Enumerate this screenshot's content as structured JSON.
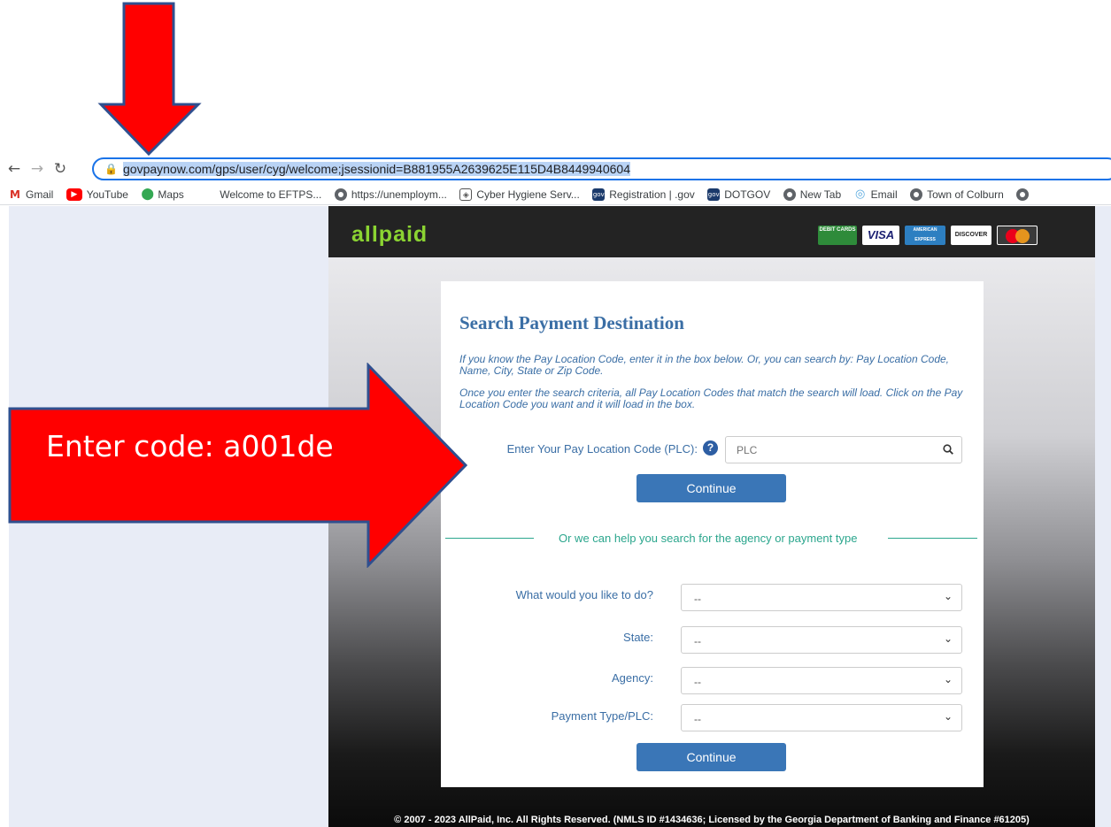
{
  "browser": {
    "url_highlighted": "govpaynow.com/gps/user/cyg/welcome",
    "url_rest": ";jsessionid=B881955A2639625E115D4B8449940604"
  },
  "bookmarks": [
    {
      "label": "Gmail",
      "icon": "gmail-icon"
    },
    {
      "label": "YouTube",
      "icon": "youtube-icon"
    },
    {
      "label": "Maps",
      "icon": "maps-icon"
    },
    {
      "label": "Welcome to EFTPS...",
      "icon": "none"
    },
    {
      "label": "https://unemploym...",
      "icon": "globe-icon"
    },
    {
      "label": "Cyber Hygiene Serv...",
      "icon": "shield-icon"
    },
    {
      "label": "Registration | .gov",
      "icon": "gov-icon"
    },
    {
      "label": "DOTGOV",
      "icon": "gov-icon"
    },
    {
      "label": "New Tab",
      "icon": "globe-icon"
    },
    {
      "label": "Email",
      "icon": "email-icon"
    },
    {
      "label": "Town of Colburn",
      "icon": "globe-icon"
    }
  ],
  "site": {
    "logo": "allpaid",
    "cards": [
      "DEBIT CARDS",
      "VISA",
      "AMERICAN EXPRESS",
      "DISCOVER",
      "mastercard"
    ],
    "title": "Search Payment Destination",
    "intro1": "If you know the Pay Location Code, enter it in the box below. Or, you can search by: Pay Location Code, Name, City, State or Zip Code.",
    "intro2": "Once you enter the search criteria, all Pay Location Codes that match the search will load. Click on the Pay Location Code you want and it will load in the box.",
    "plc_label": "Enter Your Pay Location Code (PLC):",
    "plc_placeholder": "PLC",
    "continue": "Continue",
    "help_text": "Or we can help you search for the agency or payment type",
    "selects": [
      {
        "label": "What would you like to do?",
        "value": "--"
      },
      {
        "label": "State:",
        "value": "--"
      },
      {
        "label": "Agency:",
        "value": "--"
      },
      {
        "label": "Payment Type/PLC:",
        "value": "--"
      }
    ],
    "footer": "© 2007 - 2023 AllPaid, Inc. All Rights Reserved. (NMLS ID #1434636; Licensed by the Georgia Department of Banking and Finance #61205)"
  },
  "annotation": {
    "callout": "Enter code: a001de",
    "color": "#ff0000"
  },
  "colors": {
    "accent": "#3a6ea5",
    "button": "#3a76b7",
    "divider": "#2ba68d",
    "logo": "#8bd432"
  }
}
